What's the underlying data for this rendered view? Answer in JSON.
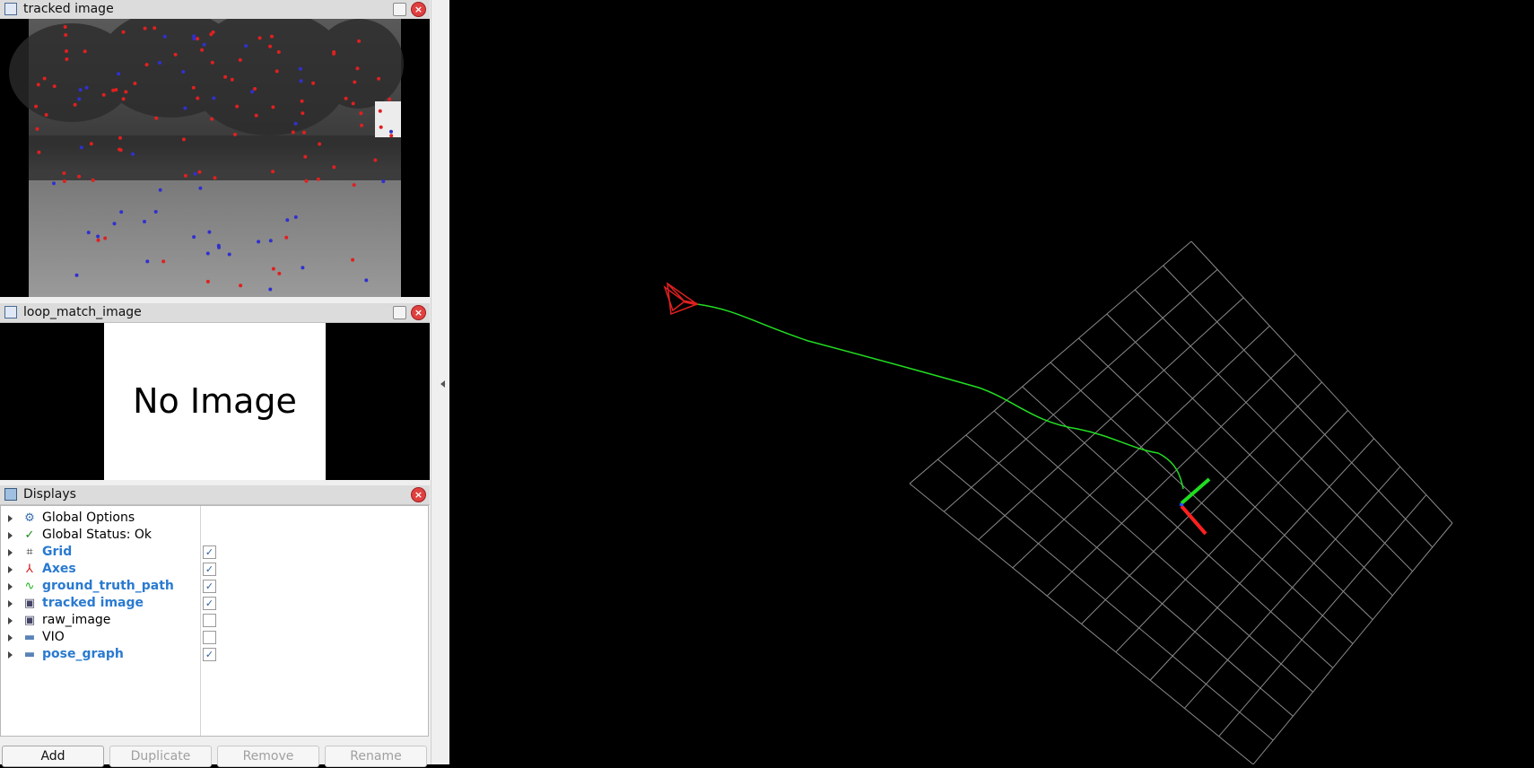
{
  "panels": {
    "tracked": {
      "title": "tracked image"
    },
    "loop": {
      "title": "loop_match_image",
      "placeholder": "No Image"
    },
    "displays": {
      "title": "Displays",
      "items": [
        {
          "label": "Global Options",
          "icon": "gear-icon",
          "checked": null,
          "enabled": false
        },
        {
          "label": "Global Status: Ok",
          "icon": "checkmark-icon",
          "checked": null,
          "enabled": false
        },
        {
          "label": "Grid",
          "icon": "grid-icon",
          "checked": true,
          "enabled": true
        },
        {
          "label": "Axes",
          "icon": "axes-icon",
          "checked": true,
          "enabled": true
        },
        {
          "label": "ground_truth_path",
          "icon": "path-icon",
          "checked": true,
          "enabled": true
        },
        {
          "label": "tracked image",
          "icon": "image-icon",
          "checked": true,
          "enabled": true
        },
        {
          "label": "raw_image",
          "icon": "image-icon",
          "checked": false,
          "enabled": false
        },
        {
          "label": "VIO",
          "icon": "folder-icon",
          "checked": false,
          "enabled": false
        },
        {
          "label": "pose_graph",
          "icon": "folder-icon",
          "checked": true,
          "enabled": true
        }
      ]
    }
  },
  "buttons": {
    "add": "Add",
    "duplicate": "Duplicate",
    "remove": "Remove",
    "rename": "Rename"
  },
  "colors": {
    "path": "#22dd22",
    "grid": "#8a8a8a",
    "camera": "#e02020",
    "axis_x": "#ff2020",
    "axis_y": "#20dd20"
  }
}
